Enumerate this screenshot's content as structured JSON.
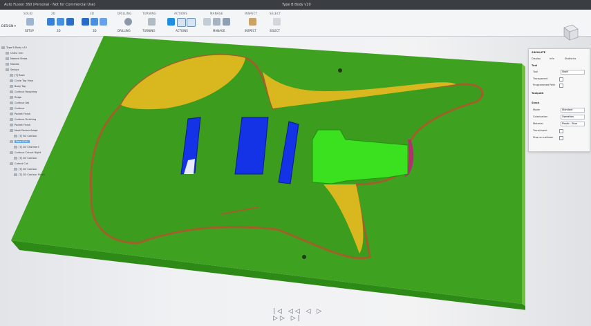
{
  "window": {
    "app_title": "Auto Fusion 360 (Personal - Not for Commercial Use)",
    "document_title": "Type B Body v10"
  },
  "toolbar": {
    "workspace": "DESIGN",
    "groups": [
      {
        "label": "SOLID",
        "sub": "SETUP"
      },
      {
        "label": "2D",
        "sub": "2D"
      },
      {
        "label": "3D",
        "sub": "3D"
      },
      {
        "label": "DRILLING",
        "sub": "DRILLING"
      },
      {
        "label": "TURNING",
        "sub": "TURNING"
      },
      {
        "label": "ACTIONS",
        "sub": "ACTIONS"
      },
      {
        "label": "MANAGE",
        "sub": "MANAGE"
      },
      {
        "label": "MODIFY",
        "sub": "MODIFY"
      },
      {
        "label": "INSPECT",
        "sub": "INSPECT"
      },
      {
        "label": "SELECT",
        "sub": "SELECT"
      }
    ]
  },
  "browser": {
    "items": [
      {
        "label": "Type B Body v10",
        "depth": 0
      },
      {
        "label": "Units: mm",
        "depth": 1
      },
      {
        "label": "Named Views",
        "depth": 1
      },
      {
        "label": "Models",
        "depth": 1
      },
      {
        "label": "Setups",
        "depth": 1
      },
      {
        "label": "[T] Back",
        "depth": 2
      },
      {
        "label": "Circle Top View",
        "depth": 2
      },
      {
        "label": "Body Top",
        "depth": 2
      },
      {
        "label": "Contour Roughing",
        "depth": 2
      },
      {
        "label": "Ridge",
        "depth": 2
      },
      {
        "label": "Contour Adj",
        "depth": 2
      },
      {
        "label": "Contour",
        "depth": 2
      },
      {
        "label": "Pocket Finish",
        "depth": 2
      },
      {
        "label": "Contour Finishing",
        "depth": 2
      },
      {
        "label": "Pocket Finish",
        "depth": 2
      },
      {
        "label": "Neck Pocket Adapt",
        "depth": 2
      },
      {
        "label": "[T] 3D Contour",
        "depth": 3
      },
      {
        "label": "Face (Ext)",
        "depth": 2,
        "selected": true
      },
      {
        "label": "[T] 2D Chamfer1",
        "depth": 3
      },
      {
        "label": "Contour Cutout Right",
        "depth": 2
      },
      {
        "label": "[T] 2D Contour",
        "depth": 3
      },
      {
        "label": "Cutout Cut",
        "depth": 2
      },
      {
        "label": "[T] 2D Contour",
        "depth": 3
      },
      {
        "label": "[T] 2D Contour Finish",
        "depth": 3
      }
    ]
  },
  "panel": {
    "title": "SIMULATE",
    "tabs": [
      "Display",
      "Info",
      "Statistics"
    ],
    "sections": [
      {
        "heading": "Tool",
        "rows": [
          {
            "label": "Tool",
            "value": "Shaft"
          },
          {
            "label": "Transparent",
            "check": true
          },
          {
            "label": "Programmed Path",
            "check": true
          }
        ]
      },
      {
        "heading": "Toolpath",
        "rows": []
      },
      {
        "heading": "Stock",
        "rows": [
          {
            "label": "Mode",
            "value": "Standard"
          },
          {
            "label": "Colorization",
            "value": "Operation"
          },
          {
            "label": "Material",
            "value": "Plastic - Blue"
          },
          {
            "label": "Translucent",
            "check": true
          },
          {
            "label": "Stop on collision",
            "check": true
          }
        ]
      }
    ]
  },
  "timeline": {
    "controls": "|◁ ◁◁ ◁ ▷ ▷▷ ▷|"
  },
  "colors": {
    "stock_top": "#3fa120",
    "stock_front": "#2e8a16",
    "stock_side": "#6fbf3a",
    "cut_wood": "#d8b81e",
    "contour_path": "#a0602a",
    "pickup_blue": "#1432e6",
    "neck_pocket": "#3be01e",
    "accent": "#0696d7"
  }
}
